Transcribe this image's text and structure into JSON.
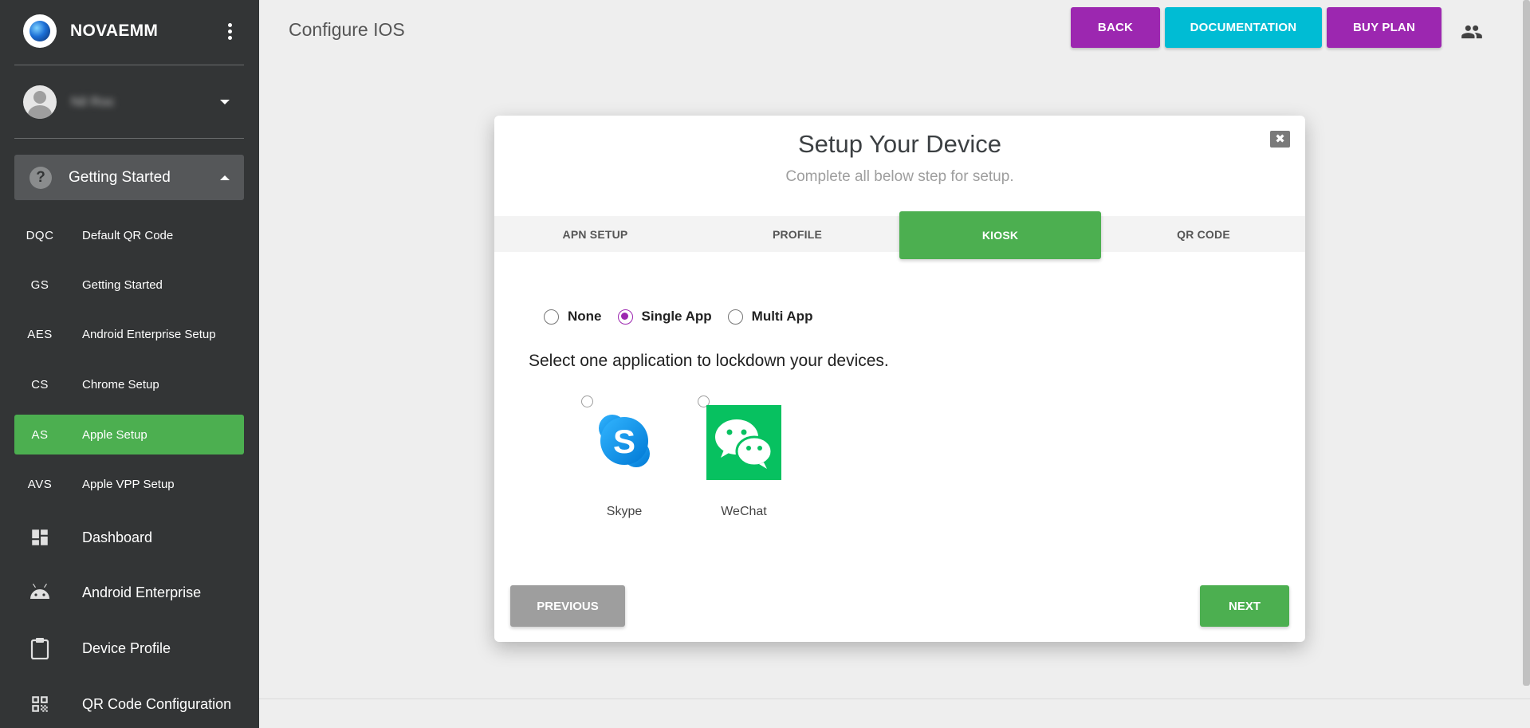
{
  "sidebar": {
    "brand": "NOVAEMM",
    "user_name": "Nil Roc",
    "section": {
      "label": "Getting Started"
    },
    "sub_items": [
      {
        "abbr": "DQC",
        "label": "Default QR Code"
      },
      {
        "abbr": "GS",
        "label": "Getting Started"
      },
      {
        "abbr": "AES",
        "label": "Android Enterprise Setup"
      },
      {
        "abbr": "CS",
        "label": "Chrome Setup"
      },
      {
        "abbr": "AS",
        "label": "Apple Setup"
      },
      {
        "abbr": "AVS",
        "label": "Apple VPP Setup"
      }
    ],
    "nav_items": [
      {
        "label": "Dashboard",
        "icon": "dashboard-icon"
      },
      {
        "label": "Android Enterprise",
        "icon": "android-icon"
      },
      {
        "label": "Device Profile",
        "icon": "clipboard-icon"
      },
      {
        "label": "QR Code Configuration",
        "icon": "qr-code-icon"
      }
    ]
  },
  "header": {
    "title": "Configure IOS",
    "back_label": "BACK",
    "documentation_label": "DOCUMENTATION",
    "buy_plan_label": "BUY PLAN"
  },
  "modal": {
    "title": "Setup Your Device",
    "subtitle": "Complete all below step for setup.",
    "close_label": "✖",
    "tabs": [
      "APN SETUP",
      "PROFILE",
      "KIOSK",
      "QR CODE"
    ],
    "active_tab": "KIOSK",
    "kiosk_modes": [
      "None",
      "Single App",
      "Multi App"
    ],
    "selected_mode": "Single App",
    "instruction": "Select one application to lockdown your devices.",
    "apps": [
      {
        "name": "Skype",
        "icon": "skype-icon"
      },
      {
        "name": "WeChat",
        "icon": "wechat-icon"
      }
    ],
    "previous_label": "PREVIOUS",
    "next_label": "NEXT"
  },
  "colors": {
    "sidebar_bg": "#333536",
    "active_green": "#4caf50",
    "purple": "#9c27b0",
    "cyan": "#00bcd4",
    "disabled_grey": "#9e9e9e"
  }
}
